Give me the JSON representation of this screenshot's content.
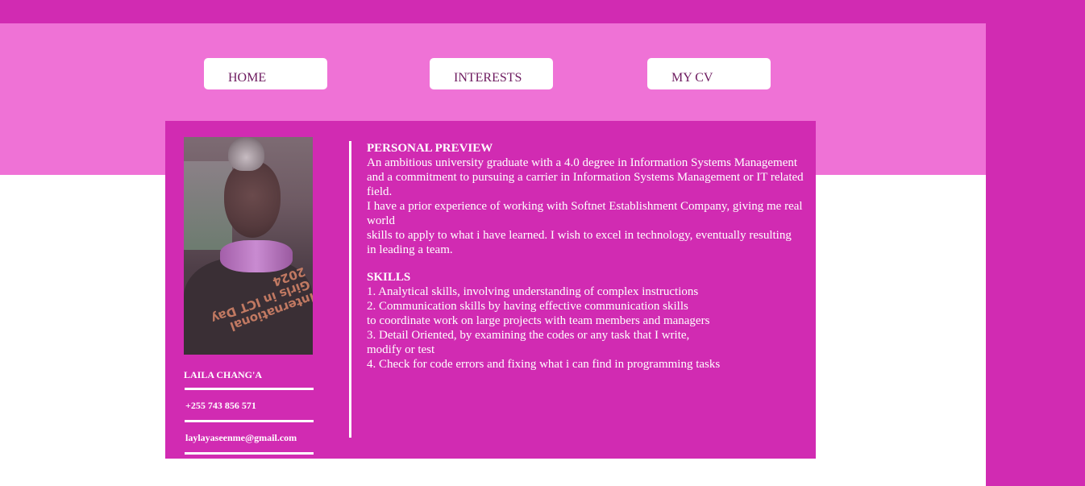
{
  "nav": {
    "home": "HOME",
    "interests": "INTERESTS",
    "cv": "MY CV"
  },
  "profile": {
    "name": "LAILA CHANG'A",
    "phone": "+255 743 856 571",
    "email": "laylayaseenme@gmail.com",
    "photo_shirt_text": "International Girls in ICT Day 2024"
  },
  "preview": {
    "title": "PERSONAL PREVIEW",
    "lines": [
      "An ambitious university graduate with a 4.0 degree in Information Systems Management",
      "and a commitment to pursuing a carrier in Information Systems Management or IT related field.",
      "I have a prior experience of working with Softnet Establishment Company, giving me real world",
      "skills to apply to what i have learned. I wish to excel in technology, eventually resulting",
      "in leading a team."
    ]
  },
  "skills": {
    "title": "SKILLS",
    "lines": [
      "1. Analytical skills, involving understanding of complex instructions",
      "2. Communication skills by having effective communication skills",
      "to coordinate work on large projects with team members and managers",
      "3. Detail Oriented, by examining the codes or any task that I write,",
      "modify or test",
      "4. Check for code errors and fixing what i can find in programming tasks"
    ]
  },
  "colors": {
    "accent": "#d12bb2",
    "header": "#ef72d6",
    "nav_text": "#6d1a5f"
  }
}
